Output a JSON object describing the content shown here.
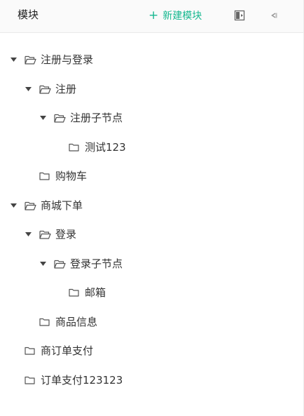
{
  "header": {
    "title": "模块",
    "add_label": "新建模块",
    "add_icon": "plus-icon",
    "expand_icon": "expand-all-icon",
    "collapse_icon": "collapse-all-icon",
    "accent_color": "#17b890"
  },
  "tree": {
    "nodes": [
      {
        "label": "注册与登录",
        "level": 0,
        "expanded": true,
        "has_children": true
      },
      {
        "label": "注册",
        "level": 1,
        "expanded": true,
        "has_children": true
      },
      {
        "label": "注册子节点",
        "level": 2,
        "expanded": true,
        "has_children": true
      },
      {
        "label": "测试123",
        "level": 3,
        "expanded": false,
        "has_children": false
      },
      {
        "label": "购物车",
        "level": 1,
        "expanded": false,
        "has_children": false
      },
      {
        "label": "商城下单",
        "level": 0,
        "expanded": true,
        "has_children": true
      },
      {
        "label": "登录",
        "level": 1,
        "expanded": true,
        "has_children": true
      },
      {
        "label": "登录子节点",
        "level": 2,
        "expanded": true,
        "has_children": true
      },
      {
        "label": "邮箱",
        "level": 3,
        "expanded": false,
        "has_children": false
      },
      {
        "label": "商品信息",
        "level": 1,
        "expanded": false,
        "has_children": false
      },
      {
        "label": "商订单支付",
        "level": 0,
        "expanded": false,
        "has_children": false
      },
      {
        "label": "订单支付123123",
        "level": 0,
        "expanded": false,
        "has_children": false
      }
    ]
  }
}
